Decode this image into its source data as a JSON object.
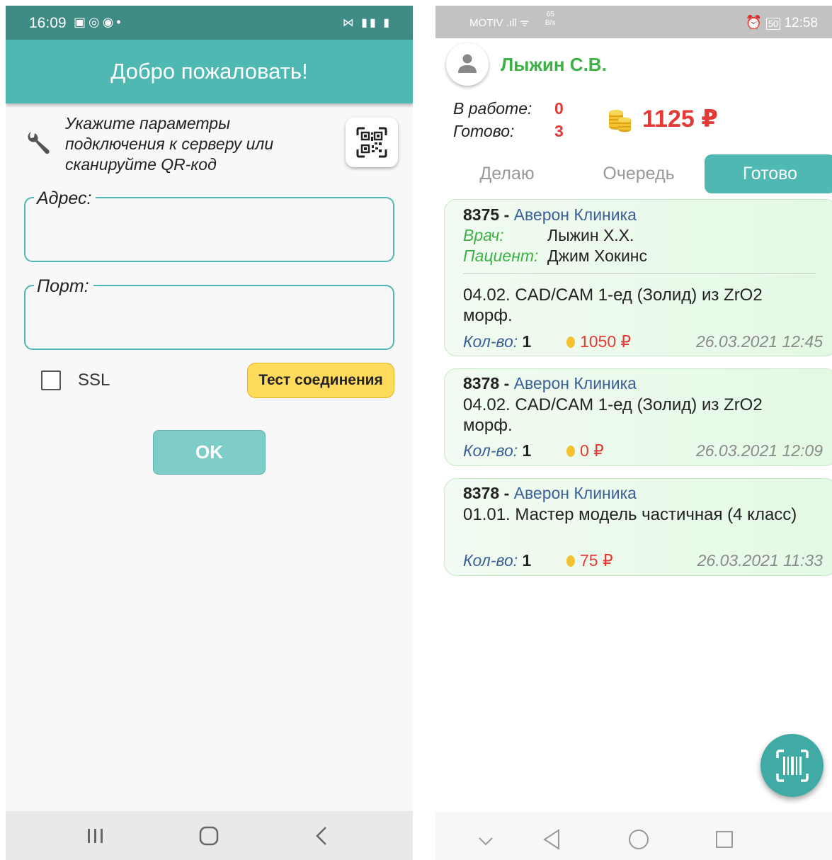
{
  "left_screen": {
    "status_bar": {
      "time": "16:09"
    },
    "app_bar": {
      "title": "Добро пожаловать!"
    },
    "instructions": "Укажите параметры подключения к серверу или сканируйте QR-код",
    "address_field": {
      "label": "Адрес:",
      "value": ""
    },
    "port_field": {
      "label": "Порт:",
      "value": ""
    },
    "ssl": {
      "label": "SSL",
      "checked": false
    },
    "test_button": {
      "label": "Тест соединения"
    },
    "ok_button": {
      "label": "OK"
    }
  },
  "right_screen": {
    "status_bar": {
      "carrier": "MOTIV",
      "speed_value": "65",
      "speed_unit": "B/s",
      "battery": "50",
      "time": "12:58"
    },
    "user": {
      "name": "Лыжин С.В."
    },
    "stats": {
      "in_work_label": "В работе:",
      "in_work_value": "0",
      "done_label": "Готово:",
      "done_value": "3"
    },
    "balance": "1125 ₽",
    "tabs": [
      {
        "label": "Делаю",
        "active": false
      },
      {
        "label": "Очередь",
        "active": false
      },
      {
        "label": "Готово",
        "active": true
      }
    ],
    "orders": [
      {
        "number": "8375",
        "separator": "-",
        "clinic": "Аверон Клиника",
        "doctor_label": "Врач:",
        "doctor": "Лыжин Х.Х.",
        "patient_label": "Пациент:",
        "patient": "Джим Хокинс",
        "description": "04.02. CAD/CAM 1-ед (Золид) из ZrO2 морф.",
        "qty_label": "Кол-во:",
        "qty": "1",
        "price": "1050 ₽",
        "date": "26.03.2021 12:45"
      },
      {
        "number": "8378",
        "separator": "-",
        "clinic": "Аверон Клиника",
        "description": "04.02. CAD/CAM 1-ед (Золид) из ZrO2 морф.",
        "qty_label": "Кол-во:",
        "qty": "1",
        "price": "0 ₽",
        "date": "26.03.2021 12:09"
      },
      {
        "number": "8378",
        "separator": "-",
        "clinic": "Аверон Клиника",
        "description": "01.01. Мастер модель частичная (4 класс)",
        "qty_label": "Кол-во:",
        "qty": "1",
        "price": "75 ₽",
        "date": "26.03.2021 11:33"
      }
    ]
  },
  "colors": {
    "teal": "#4fb8b2",
    "teal_dark": "#3f8c86",
    "green_name": "#3db046",
    "red_value": "#e53935",
    "yellow_button": "#ffdb5c",
    "clinic_blue": "#3a5f96"
  },
  "icons": [
    "wrench-icon",
    "qr-code-icon",
    "person-icon",
    "coins-icon",
    "barcode-scan-icon",
    "recent-apps-icon",
    "home-icon",
    "back-icon",
    "square-icon",
    "chevron-down-icon"
  ]
}
